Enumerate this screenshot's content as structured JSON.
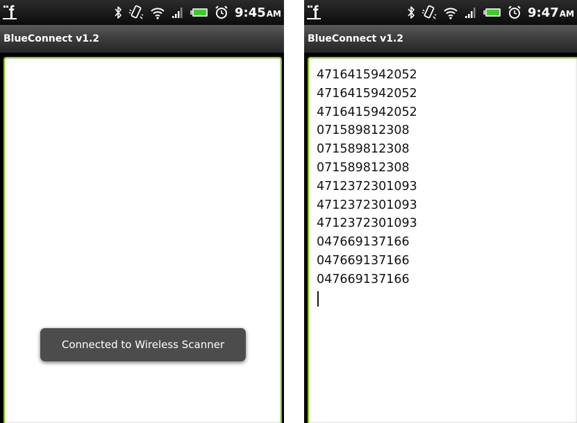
{
  "screens": [
    {
      "status": {
        "time": "9:45",
        "ampm": "AM"
      },
      "app_title": "BlueConnect v1.2",
      "textarea_lines": [],
      "toast": "Connected to Wireless Scanner"
    },
    {
      "status": {
        "time": "9:47",
        "ampm": "AM"
      },
      "app_title": "BlueConnect v1.2",
      "textarea_lines": [
        "4716415942052",
        "4716415942052",
        "4716415942052",
        "071589812308",
        "071589812308",
        "071589812308",
        "4712372301093",
        "4712372301093",
        "4712372301093",
        "047669137166",
        "047669137166",
        "047669137166"
      ]
    }
  ],
  "icons": {
    "notification": "facebook-icon",
    "status": [
      "bluetooth-icon",
      "vibrate-icon",
      "wifi-icon",
      "signal-icon",
      "battery-icon",
      "alarm-icon"
    ]
  },
  "colors": {
    "input_border": "#8fc21d",
    "battery": "#3fcc2b",
    "toast_bg": "#4c4c4c"
  }
}
